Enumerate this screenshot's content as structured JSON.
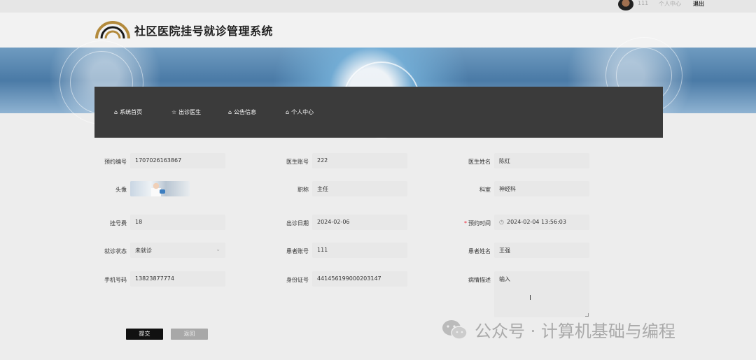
{
  "topbar": {
    "username": "111",
    "center_link": "个人中心",
    "logout": "退出"
  },
  "header": {
    "title": "社区医院挂号就诊管理系统"
  },
  "nav": [
    {
      "icon": "home-icon",
      "label": "系统首页"
    },
    {
      "icon": "star-icon",
      "label": "出诊医生"
    },
    {
      "icon": "notice-icon",
      "label": "公告信息"
    },
    {
      "icon": "home-icon",
      "label": "个人中心"
    }
  ],
  "form": {
    "appointment_no_label": "预约编号",
    "appointment_no": "1707026163867",
    "doctor_account_label": "医生账号",
    "doctor_account": "222",
    "doctor_name_label": "医生姓名",
    "doctor_name": "陈红",
    "avatar_label": "头像",
    "title_label": "职称",
    "title_value": "主任",
    "dept_label": "科室",
    "dept_value": "神经科",
    "fee_label": "挂号费",
    "fee_value": "18",
    "visit_date_label": "出诊日期",
    "visit_date": "2024-02-06",
    "appointment_time_label": "预约时间",
    "appointment_time": "2024-02-04 13:56:03",
    "status_label": "就诊状态",
    "status_value": "未就诊",
    "patient_account_label": "患者账号",
    "patient_account": "111",
    "patient_name_label": "患者姓名",
    "patient_name": "王强",
    "phone_label": "手机号码",
    "phone_value": "13823877774",
    "id_label": "身份证号",
    "id_value": "441456199000203147",
    "desc_label": "病情描述",
    "desc_value": "输入",
    "required_mark": "*"
  },
  "buttons": {
    "submit": "提交",
    "back": "返回"
  },
  "watermark": {
    "text": "公众号 · 计算机基础与编程"
  }
}
